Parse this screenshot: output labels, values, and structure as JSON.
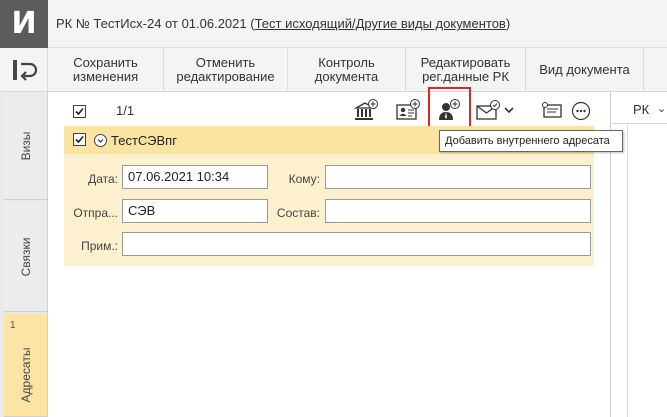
{
  "window": {
    "logo_letter": "И",
    "title_prefix": "РК № ТестИсх-24 от 01.06.2021 (",
    "title_link": "Тест исходящий/Другие виды документов",
    "title_suffix": ")"
  },
  "toolbar": {
    "back_icon": "back-arrow-icon",
    "buttons": [
      {
        "label": "Сохранить\nизменения"
      },
      {
        "label": "Отменить\nредактирование"
      },
      {
        "label": "Контроль\nдокумента"
      },
      {
        "label": "Редактировать\nрег.данные РК"
      },
      {
        "label": "Вид документа"
      }
    ]
  },
  "left_tabs": [
    {
      "label": "Визы",
      "count": ""
    },
    {
      "label": "Связки",
      "count": ""
    },
    {
      "label": "Адресаты",
      "count": "1"
    }
  ],
  "list_header": {
    "counter": "1/1",
    "icons": [
      "add-organization-icon",
      "add-contact-card-icon",
      "add-internal-addressee-icon",
      "send-mail-icon",
      "dropdown-chevron-icon",
      "comment-icon",
      "more-icon"
    ]
  },
  "tooltip": {
    "text": "Добавить внутреннего адресата"
  },
  "addressee": {
    "name": "ТестСЭВпг",
    "date_label": "Дата:",
    "date_value": "07.06.2021 10:34",
    "to_label": "Кому:",
    "to_value": "",
    "sender_label": "Отпра...",
    "sender_value": "СЭВ",
    "composition_label": "Состав:",
    "composition_value": "",
    "note_label": "Прим.:",
    "note_value": ""
  },
  "right_panel": {
    "label": "РК"
  },
  "colors": {
    "logo_bg": "#5b5b5b",
    "card_header": "#fbe3a1",
    "card_body": "#fdf0cf",
    "highlight": "#d42a2a",
    "active_tab": "#fbe4a4"
  }
}
